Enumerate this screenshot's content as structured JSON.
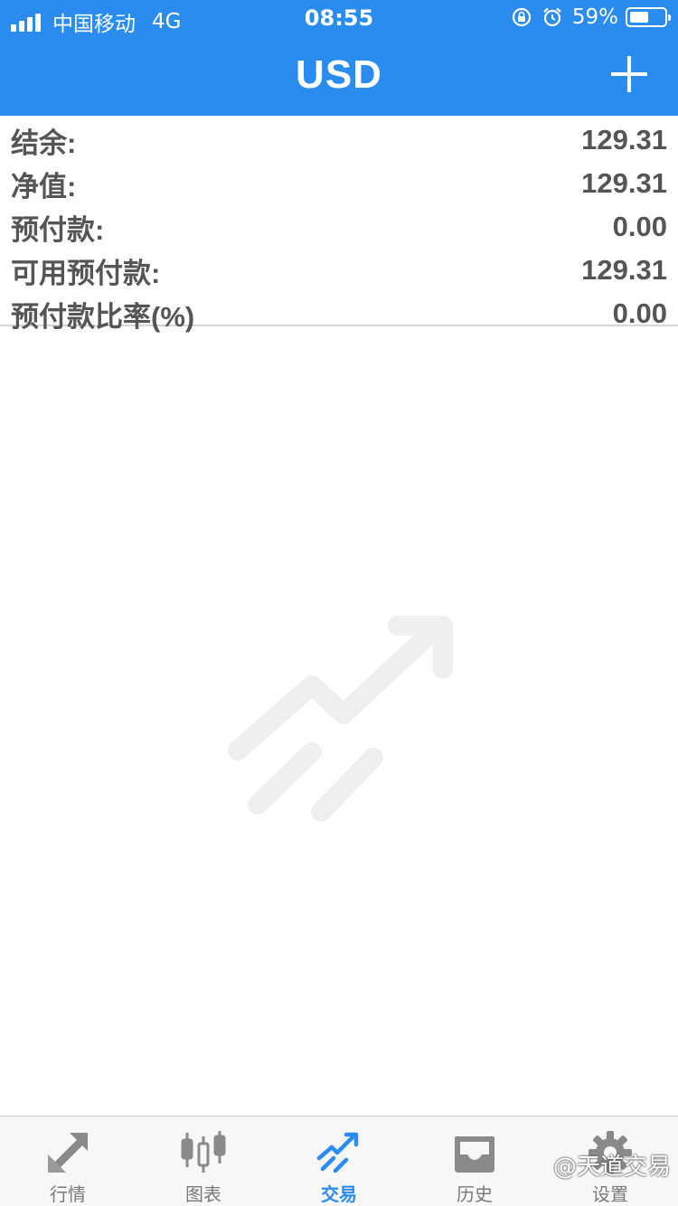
{
  "status_bar": {
    "carrier": "中国移动",
    "network": "4G",
    "time": "08:55",
    "battery": "59%"
  },
  "nav": {
    "title": "USD",
    "add_icon": "plus-icon"
  },
  "account": [
    {
      "label": "结余:",
      "value": "129.31"
    },
    {
      "label": "净值:",
      "value": "129.31"
    },
    {
      "label": "预付款:",
      "value": "0.00"
    },
    {
      "label": "可用预付款:",
      "value": "129.31"
    },
    {
      "label": "预付款比率(%)",
      "value": "0.00"
    }
  ],
  "tabs": [
    {
      "label": "行情",
      "icon": "quotes-arrows-icon",
      "active": false
    },
    {
      "label": "图表",
      "icon": "candlestick-chart-icon",
      "active": false
    },
    {
      "label": "交易",
      "icon": "trade-trend-icon",
      "active": true
    },
    {
      "label": "历史",
      "icon": "history-inbox-icon",
      "active": false
    },
    {
      "label": "设置",
      "icon": "settings-gear-icon",
      "active": false
    }
  ],
  "watermark": "@天道交易",
  "colors": {
    "primary": "#2b8cf0",
    "text": "#555555",
    "tab_inactive": "#7a7a7a",
    "illustration": "#efefef"
  }
}
